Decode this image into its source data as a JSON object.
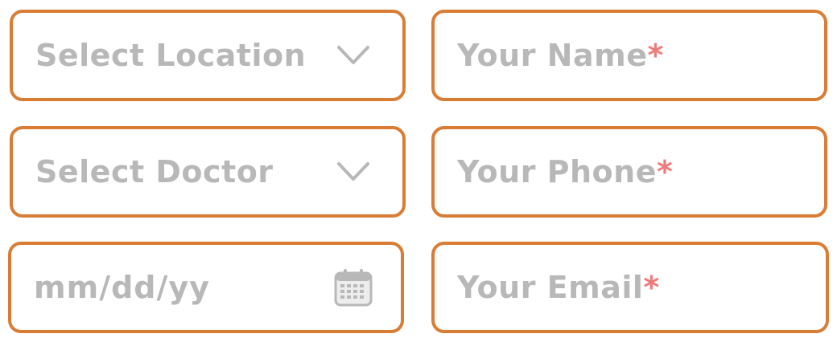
{
  "form": {
    "location": {
      "placeholder": "Select Location",
      "icon": "chevron-down-icon"
    },
    "doctor": {
      "placeholder": "Select Doctor",
      "icon": "chevron-down-icon"
    },
    "date": {
      "placeholder": "mm/dd/yy",
      "icon": "calendar-icon"
    },
    "name": {
      "placeholder": "Your Name",
      "required_mark": "*"
    },
    "phone": {
      "placeholder": "Your Phone",
      "required_mark": "*"
    },
    "email": {
      "placeholder": "Your Email",
      "required_mark": "*"
    }
  },
  "colors": {
    "border": "#D97D35",
    "placeholder": "#B8B8B8",
    "required": "#F07A7A"
  }
}
